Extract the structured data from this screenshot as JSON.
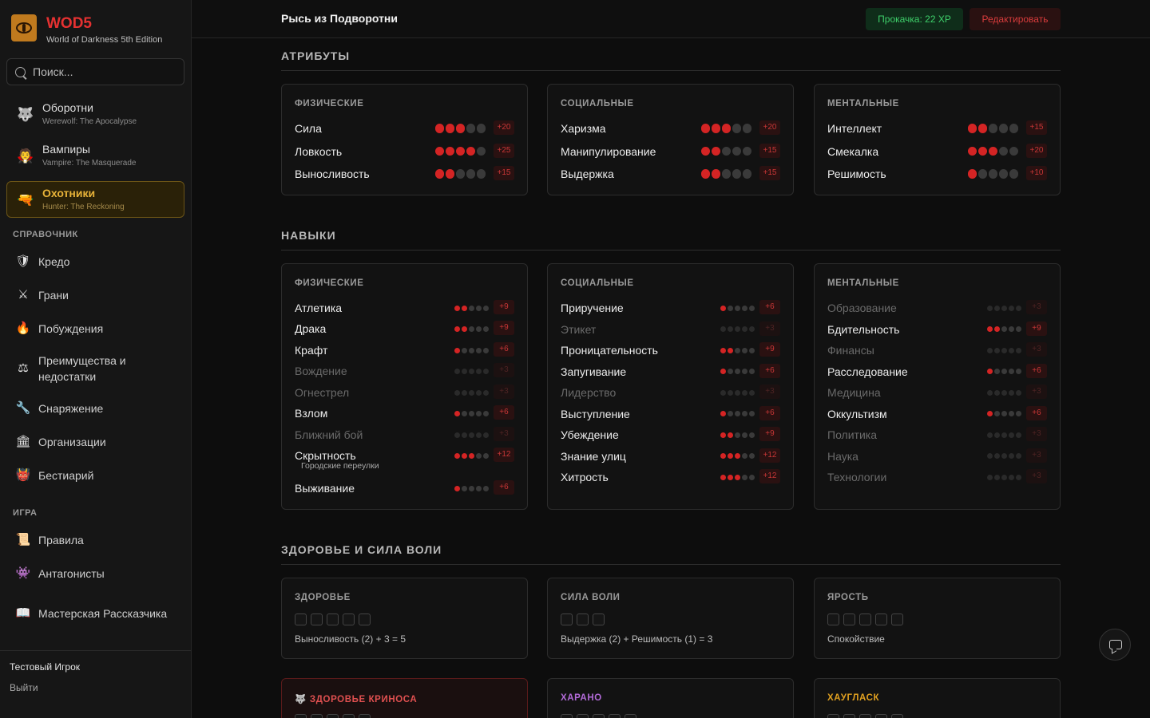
{
  "app": {
    "brand": "WOD5",
    "subtitle": "World of Darkness 5th Edition"
  },
  "sidebar": {
    "search_placeholder": "Поиск...",
    "extensions": [
      {
        "title": "Оборотни",
        "subtitle": "Werewolf: The Apocalypse",
        "icon": "wolf-icon",
        "glyph": "🐺"
      },
      {
        "title": "Вампиры",
        "subtitle": "Vampire: The Masquerade",
        "icon": "vampire-icon",
        "glyph": "🧛"
      },
      {
        "title": "Охотники",
        "subtitle": "Hunter: The Reckoning",
        "icon": "gun-icon",
        "glyph": "🔫"
      }
    ],
    "sections": [
      {
        "title": "СПРАВОЧНИК",
        "items": [
          {
            "label": "Кредо",
            "icon": "shield-icon",
            "glyph": "🛡"
          },
          {
            "label": "Грани",
            "icon": "crossed-swords-icon",
            "glyph": "⚔"
          },
          {
            "label": "Побуждения",
            "icon": "fire-icon",
            "glyph": "🔥"
          },
          {
            "label": "Преимущества и недостатки",
            "icon": "scales-icon",
            "glyph": "⚖"
          },
          {
            "label": "Снаряжение",
            "icon": "wrench-icon",
            "glyph": "🔧"
          },
          {
            "label": "Организации",
            "icon": "building-icon",
            "glyph": "🏛"
          },
          {
            "label": "Бестиарий",
            "icon": "demon-icon",
            "glyph": "👹"
          }
        ]
      },
      {
        "title": "ИГРА",
        "items": [
          {
            "label": "Правила",
            "icon": "scroll-icon",
            "glyph": "📜"
          },
          {
            "label": "Антагонисты",
            "icon": "monster-icon",
            "glyph": "👾"
          },
          {
            "label": "Мастерская Рассказчика",
            "icon": "book-icon",
            "glyph": "📖"
          }
        ]
      }
    ],
    "user": "Тестовый Игрок",
    "logout": "Выйти"
  },
  "header": {
    "title": "Рысь из Подворотни",
    "xp": "Прокачка: 22 XP",
    "edit": "Редактировать"
  },
  "colors": {
    "accent_red": "#d42424",
    "accent_gold": "#e8b339",
    "xp_green": "#3ecf6a",
    "harano": "#b36bd9",
    "hauglosk": "#e0a020"
  },
  "attributes": {
    "title": "АТРИБУТЫ",
    "groups": [
      {
        "title": "ФИЗИЧЕСКИЕ",
        "items": [
          {
            "name": "Сила",
            "value": 3,
            "xp": "+20"
          },
          {
            "name": "Ловкость",
            "value": 4,
            "xp": "+25"
          },
          {
            "name": "Выносливость",
            "value": 2,
            "xp": "+15"
          }
        ]
      },
      {
        "title": "СОЦИАЛЬНЫЕ",
        "items": [
          {
            "name": "Харизма",
            "value": 3,
            "xp": "+20"
          },
          {
            "name": "Манипулирование",
            "value": 2,
            "xp": "+15"
          },
          {
            "name": "Выдержка",
            "value": 2,
            "xp": "+15"
          }
        ]
      },
      {
        "title": "МЕНТАЛЬНЫЕ",
        "items": [
          {
            "name": "Интеллект",
            "value": 2,
            "xp": "+15"
          },
          {
            "name": "Смекалка",
            "value": 3,
            "xp": "+20"
          },
          {
            "name": "Решимость",
            "value": 1,
            "xp": "+10"
          }
        ]
      }
    ]
  },
  "skills": {
    "title": "НАВЫКИ",
    "groups": [
      {
        "title": "ФИЗИЧЕСКИЕ",
        "items": [
          {
            "name": "Атлетика",
            "value": 2,
            "xp": "+9"
          },
          {
            "name": "Драка",
            "value": 2,
            "xp": "+9"
          },
          {
            "name": "Крафт",
            "value": 1,
            "xp": "+6"
          },
          {
            "name": "Вождение",
            "value": 0,
            "xp": "+3"
          },
          {
            "name": "Огнестрел",
            "value": 0,
            "xp": "+3"
          },
          {
            "name": "Взлом",
            "value": 1,
            "xp": "+6"
          },
          {
            "name": "Ближний бой",
            "value": 0,
            "xp": "+3"
          },
          {
            "name": "Скрытность",
            "value": 3,
            "xp": "+12",
            "specialty": "Городские переулки"
          },
          {
            "name": "Выживание",
            "value": 1,
            "xp": "+6"
          }
        ]
      },
      {
        "title": "СОЦИАЛЬНЫЕ",
        "items": [
          {
            "name": "Приручение",
            "value": 1,
            "xp": "+6"
          },
          {
            "name": "Этикет",
            "value": 0,
            "xp": "+3"
          },
          {
            "name": "Проницательность",
            "value": 2,
            "xp": "+9"
          },
          {
            "name": "Запугивание",
            "value": 1,
            "xp": "+6"
          },
          {
            "name": "Лидерство",
            "value": 0,
            "xp": "+3"
          },
          {
            "name": "Выступление",
            "value": 1,
            "xp": "+6"
          },
          {
            "name": "Убеждение",
            "value": 2,
            "xp": "+9"
          },
          {
            "name": "Знание улиц",
            "value": 3,
            "xp": "+12"
          },
          {
            "name": "Хитрость",
            "value": 3,
            "xp": "+12"
          }
        ]
      },
      {
        "title": "МЕНТАЛЬНЫЕ",
        "items": [
          {
            "name": "Образование",
            "value": 0,
            "xp": "+3"
          },
          {
            "name": "Бдительность",
            "value": 2,
            "xp": "+9"
          },
          {
            "name": "Финансы",
            "value": 0,
            "xp": "+3"
          },
          {
            "name": "Расследование",
            "value": 1,
            "xp": "+6"
          },
          {
            "name": "Медицина",
            "value": 0,
            "xp": "+3"
          },
          {
            "name": "Оккультизм",
            "value": 1,
            "xp": "+6"
          },
          {
            "name": "Политика",
            "value": 0,
            "xp": "+3"
          },
          {
            "name": "Наука",
            "value": 0,
            "xp": "+3"
          },
          {
            "name": "Технологии",
            "value": 0,
            "xp": "+3"
          }
        ]
      }
    ]
  },
  "vitals": {
    "title": "ЗДОРОВЬЕ И СИЛА ВОЛИ",
    "cards": [
      {
        "title": "ЗДОРОВЬЕ",
        "boxes": 5,
        "note": "Выносливость (2) + 3 = 5"
      },
      {
        "title": "СИЛА ВОЛИ",
        "boxes": 3,
        "note": "Выдержка (2) + Решимость (1) = 3"
      },
      {
        "title": "ЯРОСТЬ",
        "boxes": 5,
        "note": "Спокойствие"
      }
    ],
    "extra": [
      {
        "title": "ЗДОРОВЬЕ КРИНОСА",
        "icon": "wolf-icon",
        "glyph": "🐺",
        "boxes": 5,
        "color": "#e05050"
      },
      {
        "title": "ХАРАНО",
        "boxes": 5,
        "color": "#b36bd9"
      },
      {
        "title": "ХАУГЛАСК",
        "boxes": 5,
        "color": "#e0a020"
      }
    ]
  }
}
